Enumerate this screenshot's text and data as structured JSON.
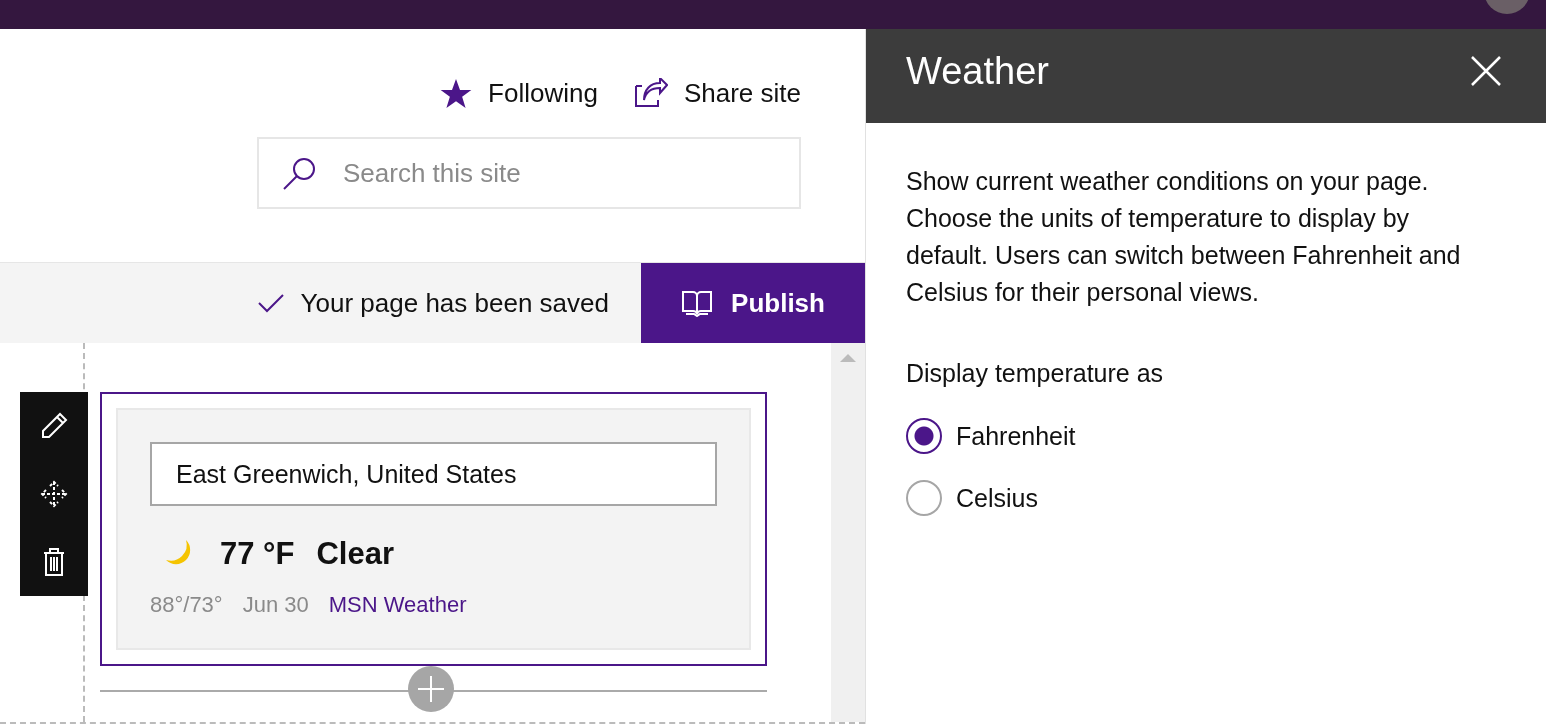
{
  "header_actions": [
    {
      "label": "Following",
      "kind": "follow"
    },
    {
      "label": "Share site",
      "kind": "share"
    }
  ],
  "search": {
    "placeholder": "Search this site"
  },
  "command_bar": {
    "status": "Your page has been saved",
    "publish_button": "Publish"
  },
  "web_part": {
    "selected": true,
    "location": "East Greenwich, United States",
    "temperature": "77 °F",
    "condition": "Clear",
    "high_low": "88°/73°",
    "date": "Jun 30",
    "source_link": "MSN Weather"
  },
  "panel": {
    "title": "Weather",
    "description": "Show current weather conditions on your page. Choose the units of temperature to display by default. Users can switch between Fahrenheit and Celsius for their personal views.",
    "option_group_label": "Display temperature as",
    "options": [
      {
        "label": "Fahrenheit",
        "selected": true
      },
      {
        "label": "Celsius",
        "selected": false
      }
    ]
  }
}
